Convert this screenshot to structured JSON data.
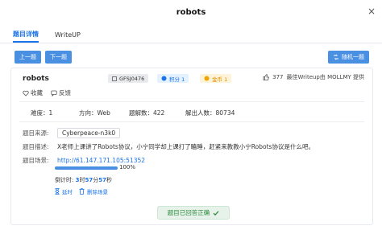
{
  "window": {
    "title": "robots",
    "close_glyph": "×"
  },
  "tabs": [
    {
      "label": "题目详情",
      "active": true
    },
    {
      "label": "WriteUP",
      "active": false
    }
  ],
  "toolbar": {
    "prev_label": "上一题",
    "next_label": "下一题",
    "random_label": "随机一题"
  },
  "problem": {
    "name": "robots",
    "id": "GFSJ0476",
    "score_label": "积分 1",
    "coin_label": "金币 1",
    "likes": "377",
    "best_writeup": "最佳Writeup由 MOLLMY 提供",
    "collect_label": "收藏",
    "feedback_label": "反馈"
  },
  "stats": {
    "difficulty": "难度：1",
    "direction": "方向：Web",
    "solve_count": "题解数：422",
    "solver_count": "解出人数：80734"
  },
  "details": {
    "source_label": "题目来源:",
    "source_value": "Cyberpeace-n3k0",
    "desc_label": "题目描述:",
    "desc_value": "X老师上课讲了Robots协议，小宁同学却上课打了瞌睡，赶紧来教教小宁Robots协议是什么吧。",
    "scene_label": "题目场景:",
    "scene_value": "http://61.147.171.105:51352"
  },
  "progress": {
    "value": 1.0,
    "label": "100%"
  },
  "countdown": {
    "prefix": "倒计时:",
    "hours": "3",
    "h": "时",
    "minutes": "57",
    "m": "分",
    "seconds": "57",
    "s": "秒"
  },
  "actions": {
    "delay_label": "延时",
    "destroy_label": "删除场景"
  },
  "status": {
    "solved_label": "题目已回答正确"
  },
  "colors": {
    "accent": "#1a73e8",
    "button": "#4a90e2",
    "success": "#2b8a3e",
    "coin": "#e28d00"
  }
}
